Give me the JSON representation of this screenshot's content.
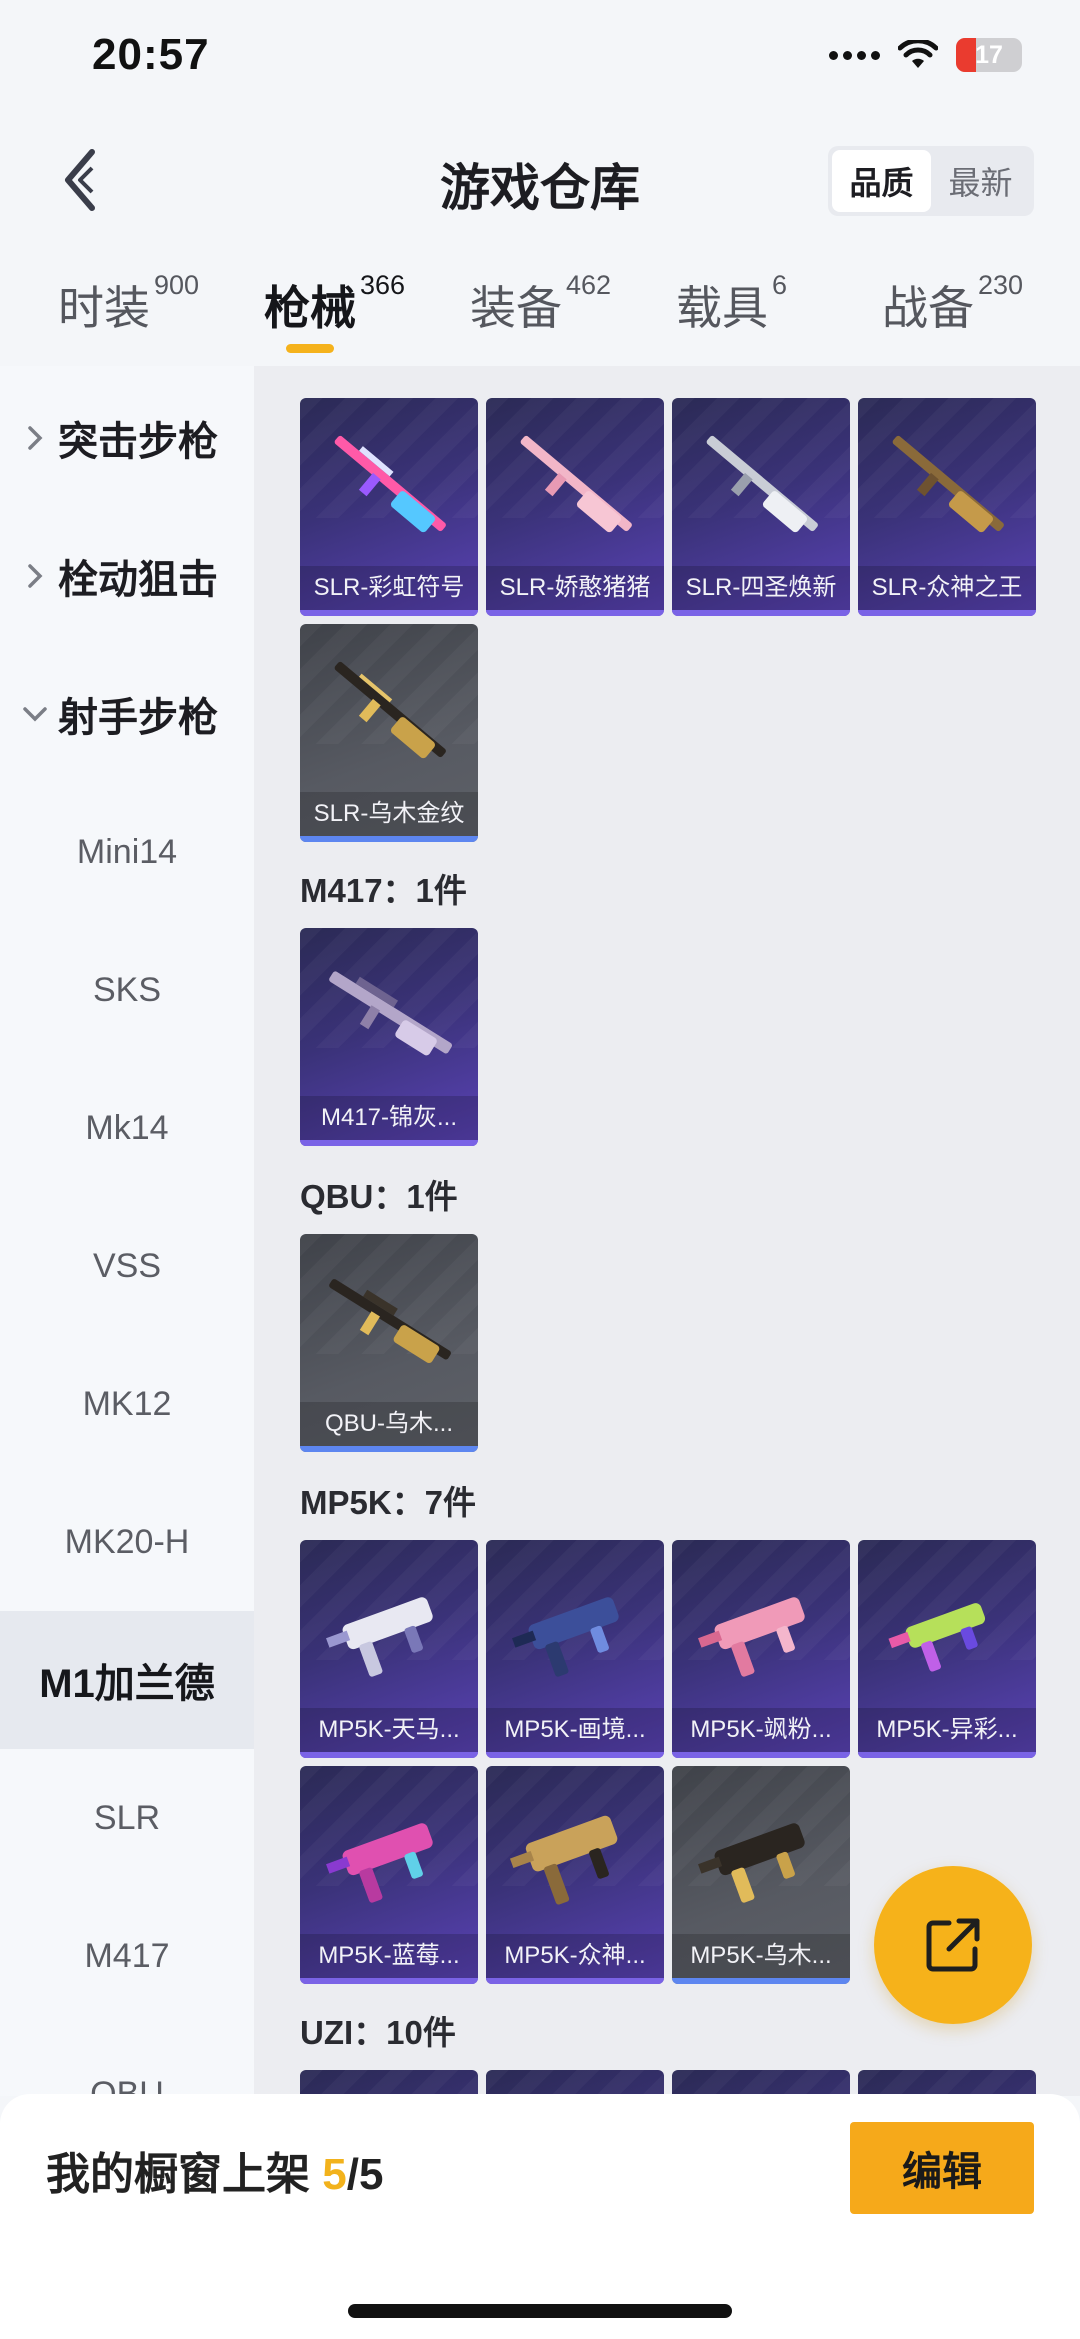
{
  "status_bar": {
    "time": "20:57",
    "battery": "17",
    "battery_level": 0.17
  },
  "header": {
    "title": "游戏仓库",
    "sort_options": [
      "品质",
      "最新"
    ],
    "active_sort": "品质"
  },
  "tabs": [
    {
      "label": "时装",
      "count": "900"
    },
    {
      "label": "枪械",
      "count": "366",
      "active": true
    },
    {
      "label": "装备",
      "count": "462"
    },
    {
      "label": "载具",
      "count": "6"
    },
    {
      "label": "战备",
      "count": "230"
    }
  ],
  "sidebar": {
    "groups": [
      {
        "label": "突击步枪",
        "expanded": false
      },
      {
        "label": "栓动狙击",
        "expanded": false
      },
      {
        "label": "射手步枪",
        "expanded": true
      }
    ],
    "items": [
      "Mini14",
      "SKS",
      "Mk14",
      "VSS",
      "MK12",
      "MK20-H",
      "M1加兰德",
      "SLR",
      "M417",
      "QBU"
    ],
    "active_item": "M1加兰德"
  },
  "content": {
    "slr_items": [
      "SLR-彩虹符号",
      "SLR-娇憨猪猪",
      "SLR-四圣焕新",
      "SLR-众神之王",
      "SLR-乌木金纹"
    ],
    "sections": [
      {
        "heading": "M417：1件",
        "items": [
          "M417-锦灰..."
        ]
      },
      {
        "heading": "QBU：1件",
        "items": [
          "QBU-乌木..."
        ]
      },
      {
        "heading": "MP5K：7件",
        "items": [
          "MP5K-天马...",
          "MP5K-画境...",
          "MP5K-飒粉...",
          "MP5K-异彩...",
          "MP5K-蓝莓...",
          "MP5K-众神...",
          "MP5K-乌木..."
        ]
      },
      {
        "heading": "UZI：10件",
        "items": []
      }
    ]
  },
  "bottom_bar": {
    "showcase_label": "我的橱窗上架 ",
    "showcase_current": "5",
    "showcase_total": "/5",
    "edit_label": "编辑"
  },
  "icons": {
    "back": "back-arrow-icon",
    "share": "share-external-icon"
  },
  "colors": {
    "accent": "#f6b21a",
    "tile_purple": "#3a3278",
    "tile_gray": "#575a62"
  }
}
